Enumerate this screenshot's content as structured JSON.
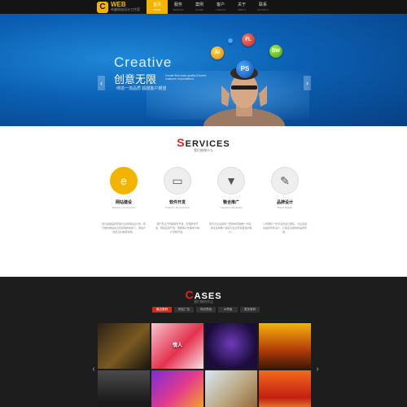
{
  "header": {
    "logo_mark": "C",
    "logo_main": "WEB",
    "logo_sub": "卓越网站设计工作室",
    "nav": [
      {
        "label": "首页",
        "en": "HOME",
        "active": true
      },
      {
        "label": "服务",
        "en": "SERVICE",
        "active": false
      },
      {
        "label": "案例",
        "en": "CASES",
        "active": false
      },
      {
        "label": "客户",
        "en": "CLIENTS",
        "active": false
      },
      {
        "label": "关于",
        "en": "ABOUT",
        "active": false
      },
      {
        "label": "联系",
        "en": "CONTACT",
        "active": false
      }
    ]
  },
  "banner": {
    "title": "Creative",
    "title_cn": "创意无限",
    "en_note": "Create first-class quality Exceed customer expectations",
    "tagline": "缔造一流品质 超越客户期望",
    "bubbles": [
      "Ai",
      "FL",
      "DW",
      "PS"
    ],
    "prev_icon": "‹",
    "next_icon": "›",
    "slide_count": 3,
    "active_slide": 1
  },
  "services": {
    "title_first": "S",
    "title_rest": "ERVICES",
    "subtitle": "我们能做什么",
    "items": [
      {
        "name": "网站建设",
        "en": "Website Construction",
        "icon": "ie-icon",
        "glyph": "e",
        "active": true,
        "desc": "我们是做品牌营销为主的网站设计的，我们做的网站在没有营销的前提下，网站才能真正的发挥作用。"
      },
      {
        "name": "软件开发",
        "en": "Software development",
        "icon": "monitor-icon",
        "glyph": "▭",
        "active": false,
        "desc": "我们专注于网络软件开发，管理软件开发，网站应用开发，根据客户的需求为客户定制开发。"
      },
      {
        "name": "整合推广",
        "en": "Integrated Marketing",
        "icon": "tie-icon",
        "glyph": "▼",
        "active": false,
        "desc": "我们为企业提供一套整体营销推广方案，通过多种推广渠道为企业带来更多的客户。"
      },
      {
        "name": "品牌设计",
        "en": "Brand Design",
        "icon": "person-icon",
        "glyph": "✎",
        "active": false,
        "desc": "公司拥有一支专业的设计团队，为企业提供品牌形象设计，打造企业独特的品牌形象。"
      }
    ]
  },
  "cases": {
    "title_first": "C",
    "title_rest": "ASES",
    "subtitle": "我们做的作品",
    "tabs": [
      {
        "label": "最近案例",
        "active": true
      },
      {
        "label": "网站广告",
        "active": false
      },
      {
        "label": "网页界面",
        "active": false
      },
      {
        "label": "UI界面",
        "active": false
      },
      {
        "label": "更多案例",
        "active": false
      }
    ],
    "prev_icon": "‹",
    "next_icon": "›",
    "tiles": [
      {
        "label": "",
        "bg": "linear-gradient(135deg,#2b2116,#7a5a22 55%,#1a140c)"
      },
      {
        "label": "情人",
        "bg": "linear-gradient(135deg,#f7c6d0,#e3324f 55%,#f9e2e6)"
      },
      {
        "label": "",
        "bg": "radial-gradient(circle at 50% 45%,#6d3bb8,#1b0c3a 70%)"
      },
      {
        "label": "",
        "bg": "linear-gradient(180deg,#f5b20b,#b23a0a 60%,#3b1a06)"
      },
      {
        "label": "",
        "bg": "linear-gradient(180deg,#4a4a4a,#1a1a1a 70%)"
      },
      {
        "label": "",
        "bg": "linear-gradient(135deg,#7b2bd8,#e53c8a 50%,#f7b81a)"
      },
      {
        "label": "",
        "bg": "linear-gradient(135deg,#d9e7f5,#b9a37c 55%,#8a5a2a)"
      },
      {
        "label": "",
        "bg": "linear-gradient(180deg,#f26a1b,#c41f12 60%,#f6c34a)"
      }
    ]
  }
}
